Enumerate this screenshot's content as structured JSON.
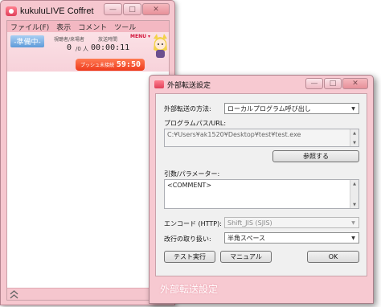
{
  "main_window": {
    "title": "kukuluLIVE Coffret",
    "caption_buttons": {
      "minimize": "—",
      "maximize": "□",
      "close": "✕"
    },
    "menu": [
      "ファイル(F)",
      "表示",
      "コメント",
      "ツール"
    ],
    "status": {
      "badge": "-準備中-",
      "viewers_label": "視聴者/来場者",
      "viewers_value": "0",
      "viewers_unit": "/0 人",
      "time_label": "放送時間",
      "time_value": "00:00:11",
      "menu_link": "MENU ▾",
      "push_label": "プッシュ未接続",
      "push_time": "59:50"
    }
  },
  "dialog": {
    "title": "外部転送設定",
    "caption_buttons": {
      "minimize": "—",
      "maximize": "□",
      "close": "✕"
    },
    "method_label": "外部転送の方法:",
    "method_value": "ローカルプログラム呼び出し",
    "program_label": "プログラムパス/URL:",
    "program_value": "C:¥Users¥ak1520¥Desktop¥test¥test.exe",
    "browse_button": "参照する",
    "args_label": "引数/パラメーター:",
    "args_value": "<COMMENT>",
    "encode_label": "エンコード (HTTP):",
    "encode_value": "Shift_JIS (SJIS)",
    "newline_label": "改行の取り扱い:",
    "newline_value": "半角スペース",
    "test_button": "テスト実行",
    "manual_button": "マニュアル",
    "ok_button": "OK",
    "banner": "外部転送設定"
  },
  "colors": {
    "frame_pink": "#f6c7cf",
    "status_badge_blue": "#6fa6dd",
    "push_bar_orange": "#ee4a22",
    "menu_link_red": "#d2133a"
  }
}
